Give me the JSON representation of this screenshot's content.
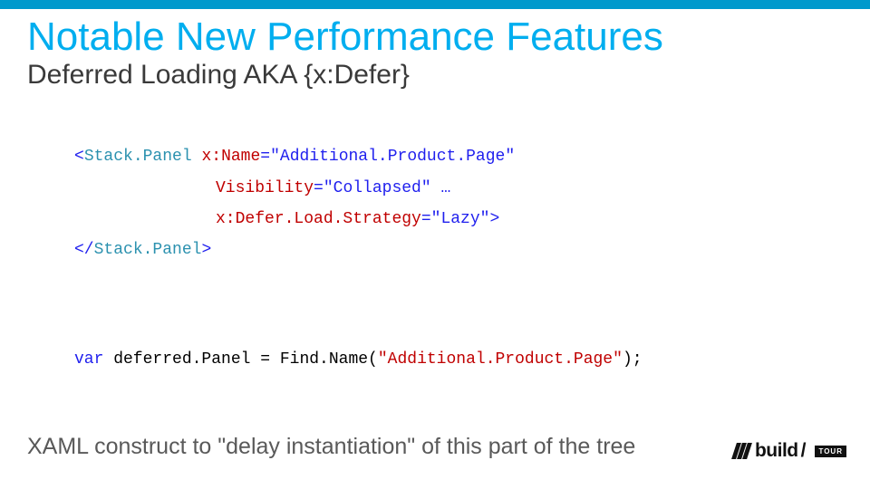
{
  "title": "Notable New Performance Features",
  "subtitle": "Deferred Loading AKA {x:Defer}",
  "code": {
    "xaml": {
      "open_bracket": "<",
      "elem": "Stack.Panel",
      "sp1": " ",
      "attr1": "x:",
      "attr1b": "Name",
      "eq": "=\"",
      "val1": "Additional.Product.Page",
      "qend": "\"",
      "attr2": "Visibility",
      "val2": "Collapsed",
      "ellipsis": " …",
      "attr3a": "x:",
      "attr3b": "Defer.Load.Strategy",
      "val3": "Lazy",
      "close_gt": "\">",
      "close_tag_open": "</",
      "close_tag_name": "Stack.Panel",
      "close_tag_end": ">"
    },
    "cs": {
      "kw": "var",
      "ident": " deferred.Panel = Find.Name(",
      "q1": "\"",
      "arg": "Additional.Product.Page",
      "q2": "\"",
      "tail": ");"
    }
  },
  "bottom_note": "XAML construct to \"delay instantiation\" of this part of the tree",
  "footer": {
    "brand": "build",
    "trailing_slash": "/",
    "badge": "TOUR"
  }
}
